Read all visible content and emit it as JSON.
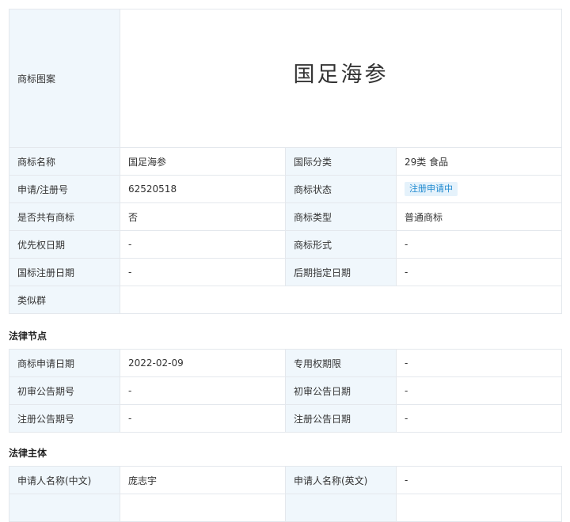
{
  "trademark_info": {
    "image_label": "商标图案",
    "image_text": "国足海参",
    "rows": [
      {
        "l1": "商标名称",
        "v1": "国足海参",
        "l2": "国际分类",
        "v2": "29类 食品"
      },
      {
        "l1": "申请/注册号",
        "v1": "62520518",
        "l2": "商标状态",
        "v2": "注册申请中"
      },
      {
        "l1": "是否共有商标",
        "v1": "否",
        "l2": "商标类型",
        "v2": "普通商标"
      },
      {
        "l1": "优先权日期",
        "v1": "-",
        "l2": "商标形式",
        "v2": "-"
      },
      {
        "l1": "国标注册日期",
        "v1": "-",
        "l2": "后期指定日期",
        "v2": "-"
      }
    ],
    "similar_group_label": "类似群",
    "similar_group_value": ""
  },
  "legal_nodes": {
    "title": "法律节点",
    "rows": [
      {
        "l1": "商标申请日期",
        "v1": "2022-02-09",
        "l2": "专用权期限",
        "v2": "-"
      },
      {
        "l1": "初审公告期号",
        "v1": "-",
        "l2": "初审公告日期",
        "v2": "-"
      },
      {
        "l1": "注册公告期号",
        "v1": "-",
        "l2": "注册公告日期",
        "v2": "-"
      }
    ]
  },
  "legal_entity": {
    "title": "法律主体",
    "rows": [
      {
        "l1": "申请人名称(中文)",
        "v1": "庞志宇",
        "l2": "申请人名称(英文)",
        "v2": "-"
      }
    ]
  }
}
